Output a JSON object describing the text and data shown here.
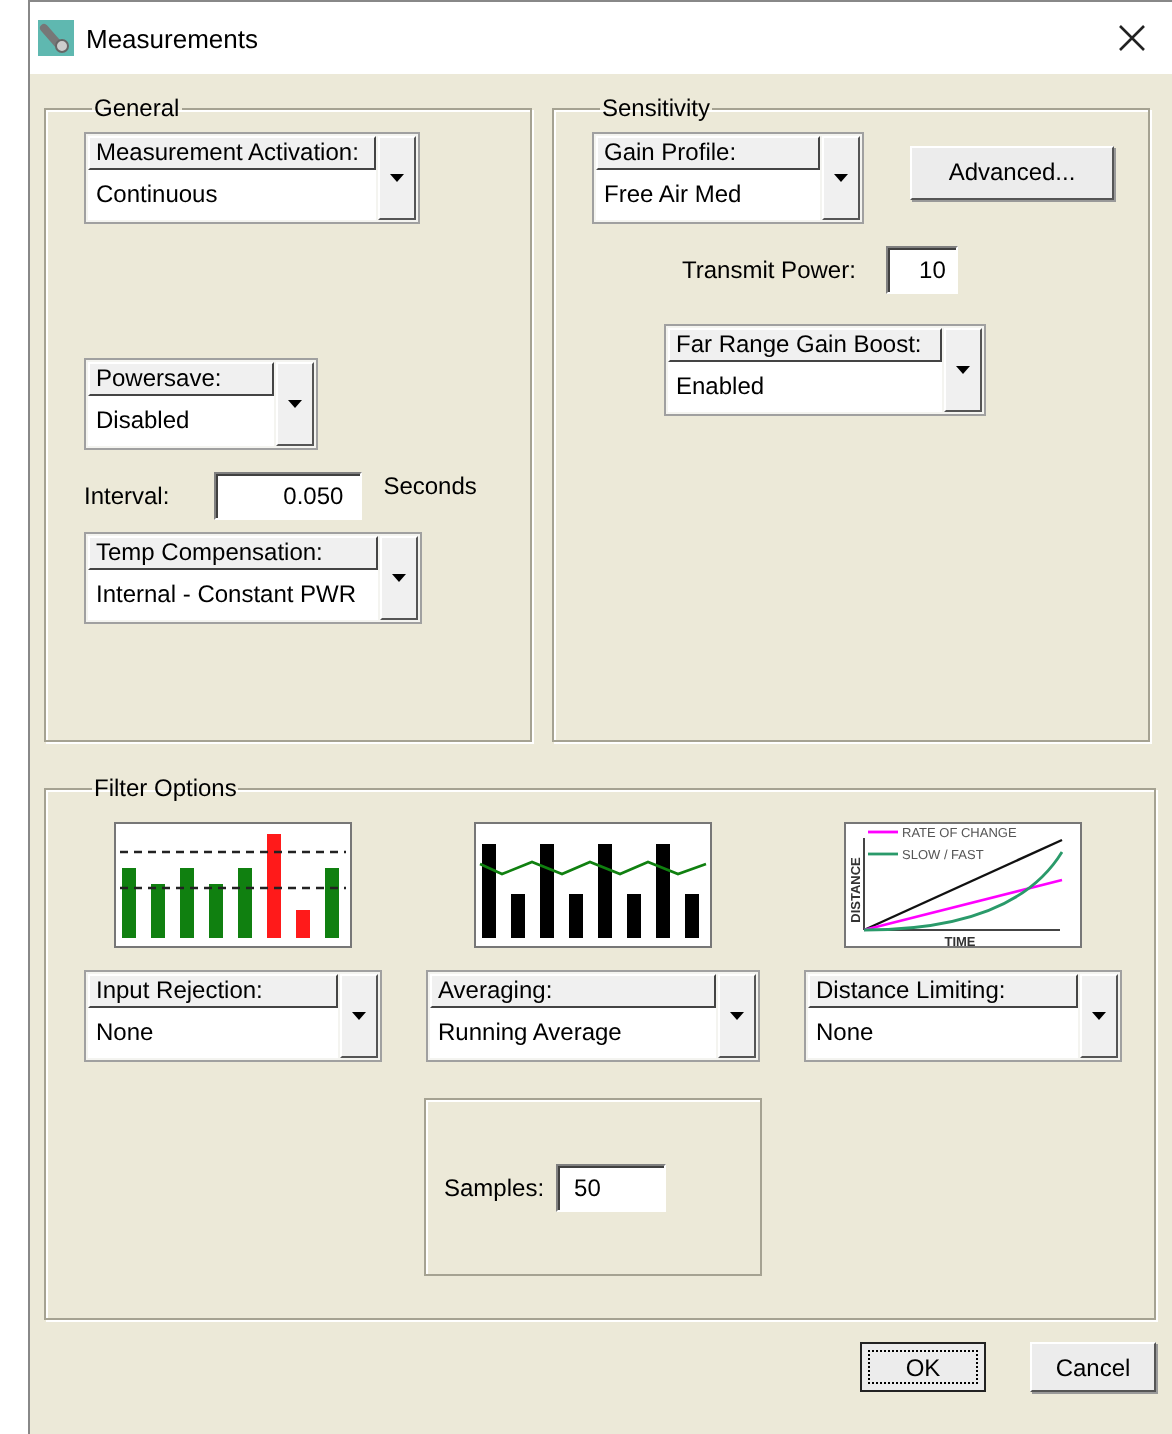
{
  "window": {
    "title": "Measurements"
  },
  "general": {
    "title": "General",
    "activation": {
      "label": "Measurement Activation:",
      "value": "Continuous"
    },
    "powersave": {
      "label": "Powersave:",
      "value": "Disabled"
    },
    "interval": {
      "label": "Interval:",
      "value": "0.050",
      "unit": "Seconds"
    },
    "temp_compensation": {
      "label": "Temp Compensation:",
      "value": "Internal - Constant PWR"
    }
  },
  "sensitivity": {
    "title": "Sensitivity",
    "gain_profile": {
      "label": "Gain Profile:",
      "value": "Free Air Med"
    },
    "advanced_button": "Advanced...",
    "transmit_power": {
      "label": "Transmit Power:",
      "value": "10"
    },
    "far_range_gain_boost": {
      "label": "Far Range Gain Boost:",
      "value": "Enabled"
    }
  },
  "filter_options": {
    "title": "Filter Options",
    "filters": [
      {
        "kind": "rejection",
        "label": "Input Rejection:",
        "value": "None"
      },
      {
        "kind": "averaging",
        "label": "Averaging:",
        "value": "Running Average",
        "samples": {
          "label": "Samples:",
          "value": "50"
        }
      },
      {
        "kind": "limiting",
        "label": "Distance Limiting:",
        "value": "None",
        "legend": [
          "RATE OF CHANGE",
          "SLOW / FAST"
        ],
        "xlabel": "TIME",
        "ylabel": "DISTANCE"
      }
    ]
  },
  "buttons": [
    {
      "label": "OK",
      "default": true
    },
    {
      "label": "Cancel",
      "default": false
    }
  ]
}
